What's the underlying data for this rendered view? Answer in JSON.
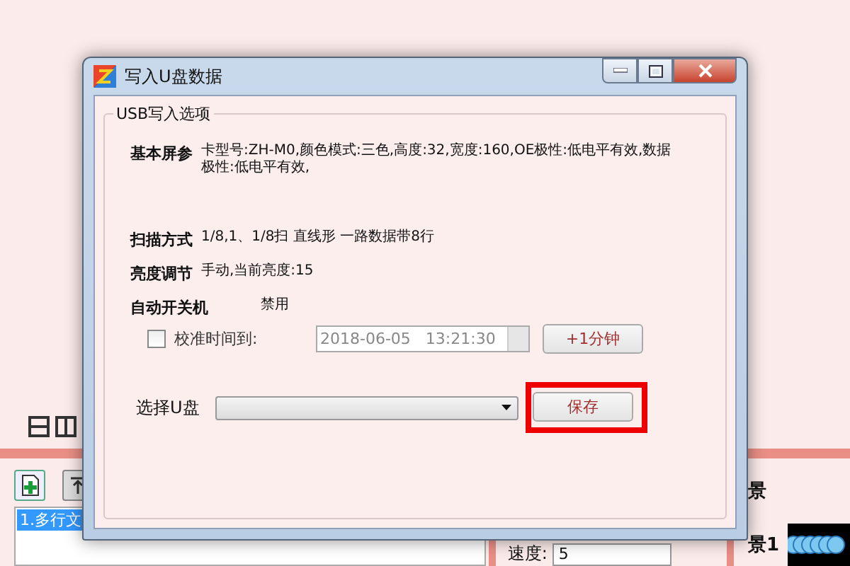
{
  "background": {
    "list_items": [
      {
        "text": "1.多行文",
        "selected": true
      }
    ],
    "side_labels": [
      "景",
      "景1"
    ],
    "speed": {
      "label": "速度:",
      "value": "5"
    }
  },
  "dialog": {
    "title": "写入U盘数据",
    "group_title": "USB写入选项",
    "settings": [
      {
        "label": "基本屏参",
        "value": "卡型号:ZH-M0,颜色模式:三色,高度:32,宽度:160,OE极性:低电平有效,数据极性:低电平有效,"
      },
      {
        "label": "扫描方式",
        "value": "1/8,1、1/8扫 直线形 一路数据带8行"
      },
      {
        "label": "亮度调节",
        "value": "手动,当前亮度:15"
      },
      {
        "label": "自动开关机",
        "value": "禁用"
      }
    ],
    "calibrate": {
      "label": "校准时间到:",
      "checked": false,
      "datetime": "2018-06-05   13:21:30",
      "add_button": "+1分钟"
    },
    "drive": {
      "label": "选择U盘",
      "save_button": "保存",
      "highlighted": true
    }
  }
}
